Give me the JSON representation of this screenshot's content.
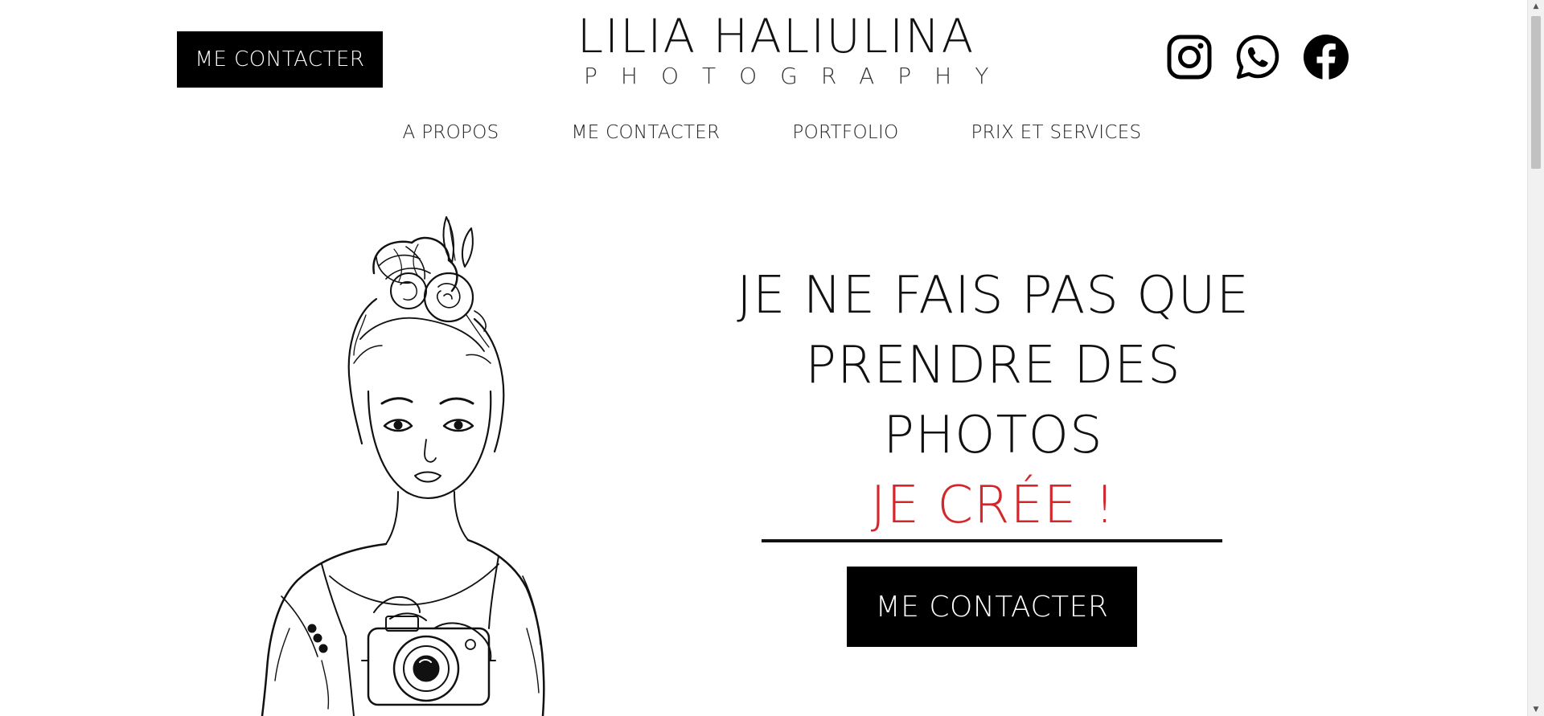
{
  "header": {
    "contact_button": "ME CONTACTER",
    "brand_name": "LILIA HALIULINA",
    "brand_sub": "PHOTOGRAPHY",
    "social": [
      {
        "icon": "instagram-icon"
      },
      {
        "icon": "whatsapp-icon"
      },
      {
        "icon": "facebook-icon"
      }
    ]
  },
  "nav": {
    "items": [
      {
        "label": "A PROPOS"
      },
      {
        "label": "ME CONTACTER"
      },
      {
        "label": "PORTFOLIO"
      },
      {
        "label": "PRIX ET SERVICES"
      }
    ]
  },
  "hero": {
    "line1": "JE NE FAIS PAS QUE",
    "line2": "PRENDRE DES",
    "line3": "PHOTOS",
    "accent": "JE CRÉE !",
    "cta": "ME CONTACTER"
  },
  "colors": {
    "accent": "#d3272c",
    "button_bg": "#000000",
    "button_text": "#ffffff"
  }
}
